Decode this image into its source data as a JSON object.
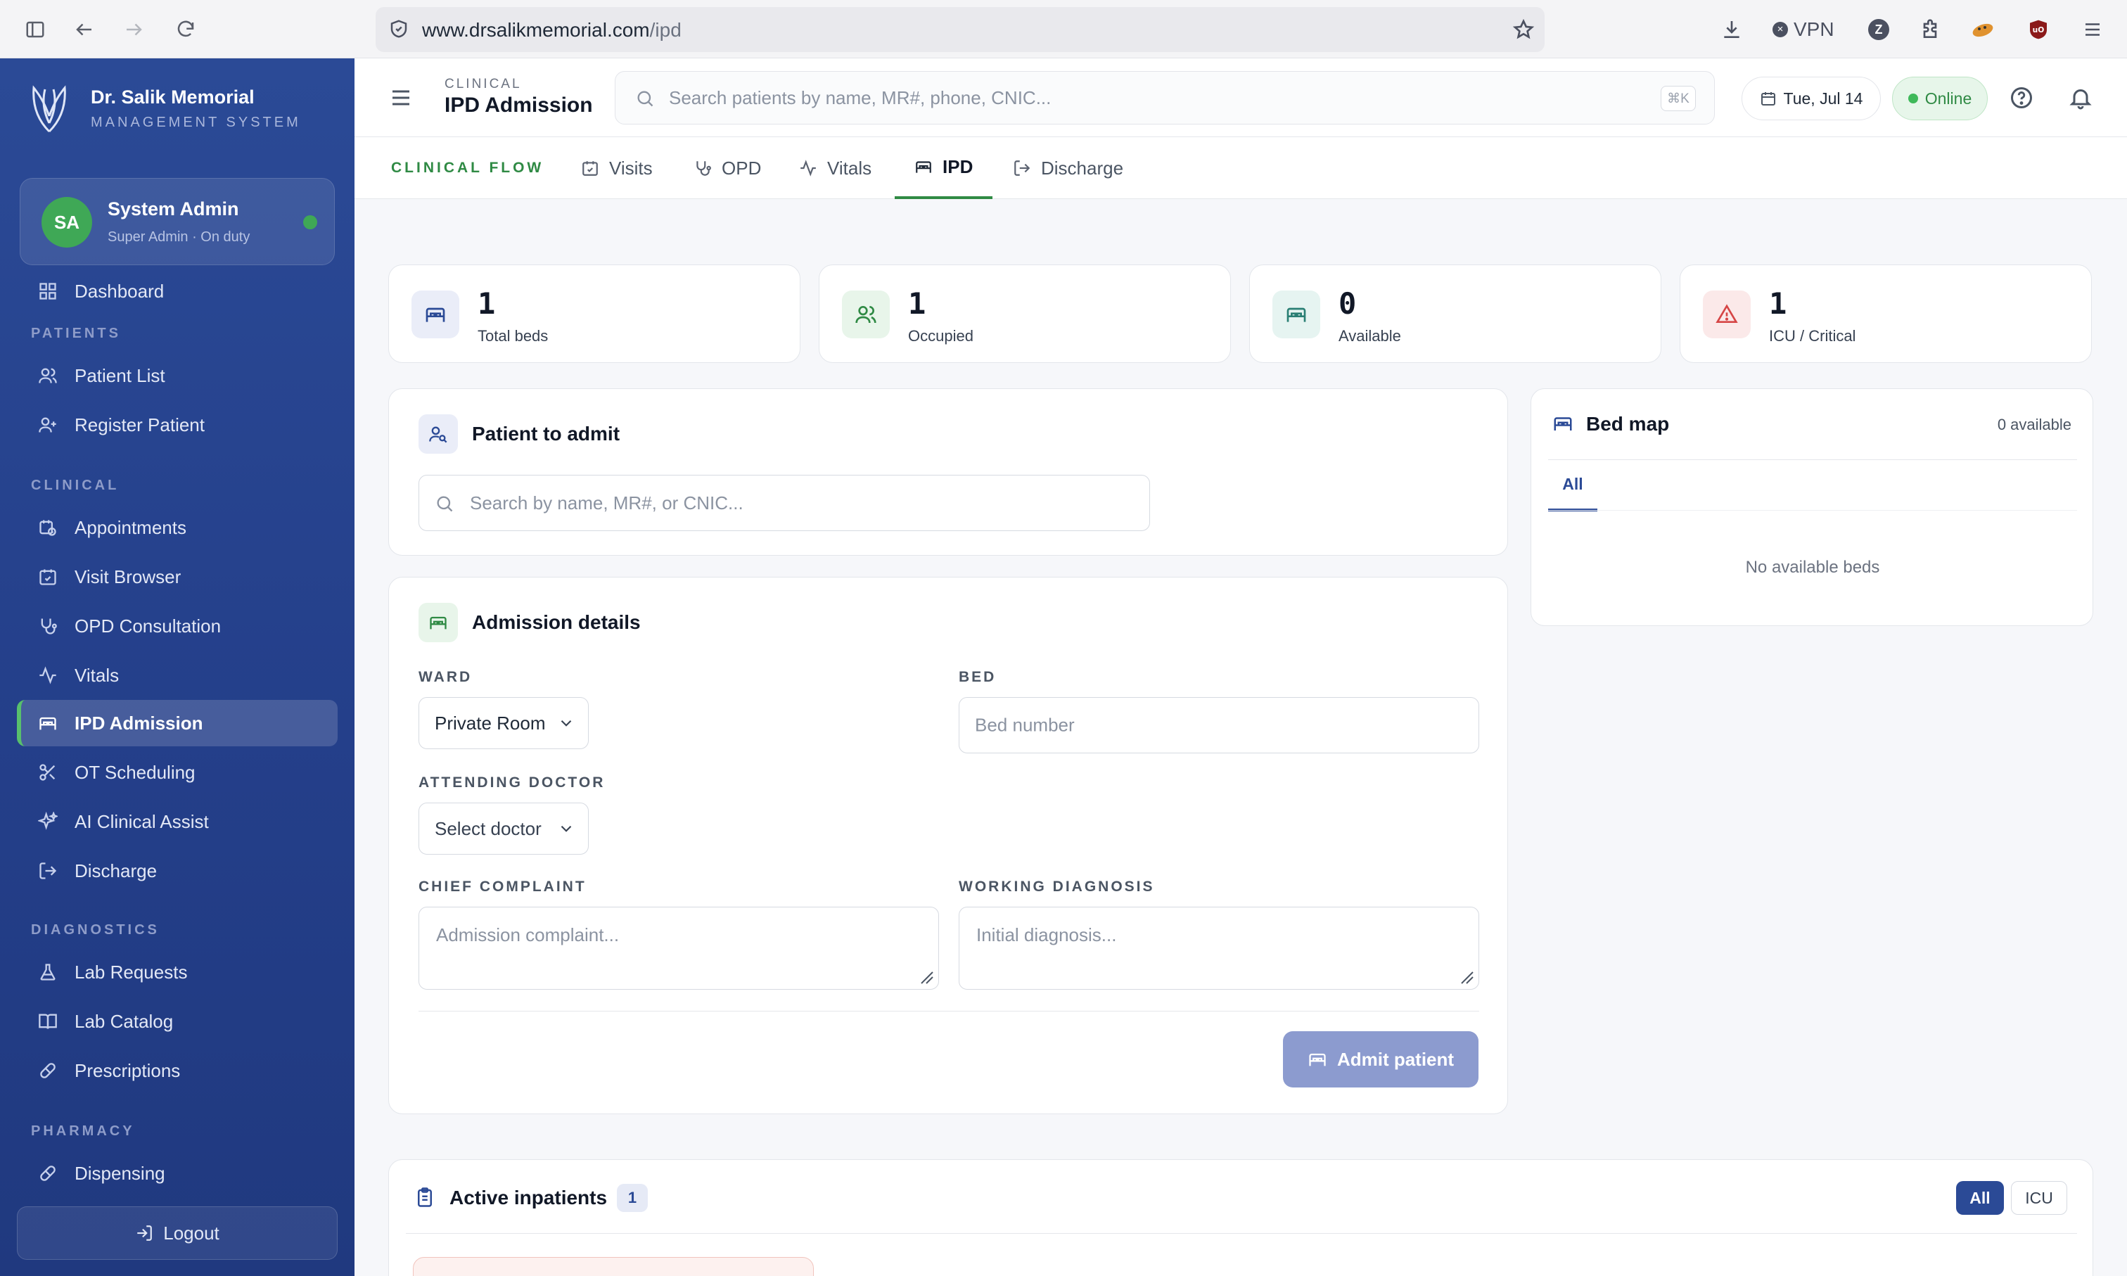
{
  "browser": {
    "url_host": "www.drsalikmemorial.com",
    "url_path": "/ipd",
    "vpn_label": "VPN"
  },
  "sidebar": {
    "brand_name": "Dr. Salik Memorial",
    "brand_sub": "MANAGEMENT SYSTEM",
    "user": {
      "initials": "SA",
      "name": "System Admin",
      "role": "Super Admin · On duty"
    },
    "dashboard": "Dashboard",
    "sections": {
      "patients": "PATIENTS",
      "clinical": "CLINICAL",
      "diagnostics": "DIAGNOSTICS",
      "pharmacy": "PHARMACY"
    },
    "items": {
      "patient_list": "Patient List",
      "register_patient": "Register Patient",
      "appointments": "Appointments",
      "visit_browser": "Visit Browser",
      "opd_consultation": "OPD Consultation",
      "vitals": "Vitals",
      "ipd_admission": "IPD Admission",
      "ot_scheduling": "OT Scheduling",
      "ai_clinical_assist": "AI Clinical Assist",
      "discharge": "Discharge",
      "lab_requests": "Lab Requests",
      "lab_catalog": "Lab Catalog",
      "prescriptions": "Prescriptions",
      "dispensing": "Dispensing"
    },
    "logout": "Logout"
  },
  "header": {
    "section": "CLINICAL",
    "title": "IPD Admission",
    "search_placeholder": "Search patients by name, MR#, phone, CNIC...",
    "shortcut": "⌘K",
    "date": "Tue, Jul 14",
    "status": "Online"
  },
  "flow": {
    "label": "CLINICAL FLOW",
    "tabs": [
      "Visits",
      "OPD",
      "Vitals",
      "IPD",
      "Discharge"
    ],
    "active": "IPD"
  },
  "stats": [
    {
      "value": "1",
      "label": "Total beds"
    },
    {
      "value": "1",
      "label": "Occupied"
    },
    {
      "value": "0",
      "label": "Available"
    },
    {
      "value": "1",
      "label": "ICU / Critical"
    }
  ],
  "patient_to_admit": {
    "title": "Patient to admit",
    "search_placeholder": "Search by name, MR#, or CNIC..."
  },
  "admission": {
    "title": "Admission details",
    "ward_label": "WARD",
    "ward_value": "Private Room",
    "bed_label": "BED",
    "bed_placeholder": "Bed number",
    "doctor_label": "ATTENDING DOCTOR",
    "doctor_value": "Select doctor",
    "complaint_label": "CHIEF COMPLAINT",
    "complaint_placeholder": "Admission complaint...",
    "diagnosis_label": "WORKING DIAGNOSIS",
    "diagnosis_placeholder": "Initial diagnosis...",
    "submit": "Admit patient"
  },
  "bed_map": {
    "title": "Bed map",
    "available": "0 available",
    "tab": "All",
    "empty": "No available beds"
  },
  "inpatients": {
    "title": "Active inpatients",
    "count": "1",
    "filters": [
      "All",
      "ICU"
    ]
  },
  "colors": {
    "sidebar": "#2b4a96",
    "accent_green": "#2f8a44",
    "primary": "#2b4a96",
    "danger": "#d64545"
  }
}
